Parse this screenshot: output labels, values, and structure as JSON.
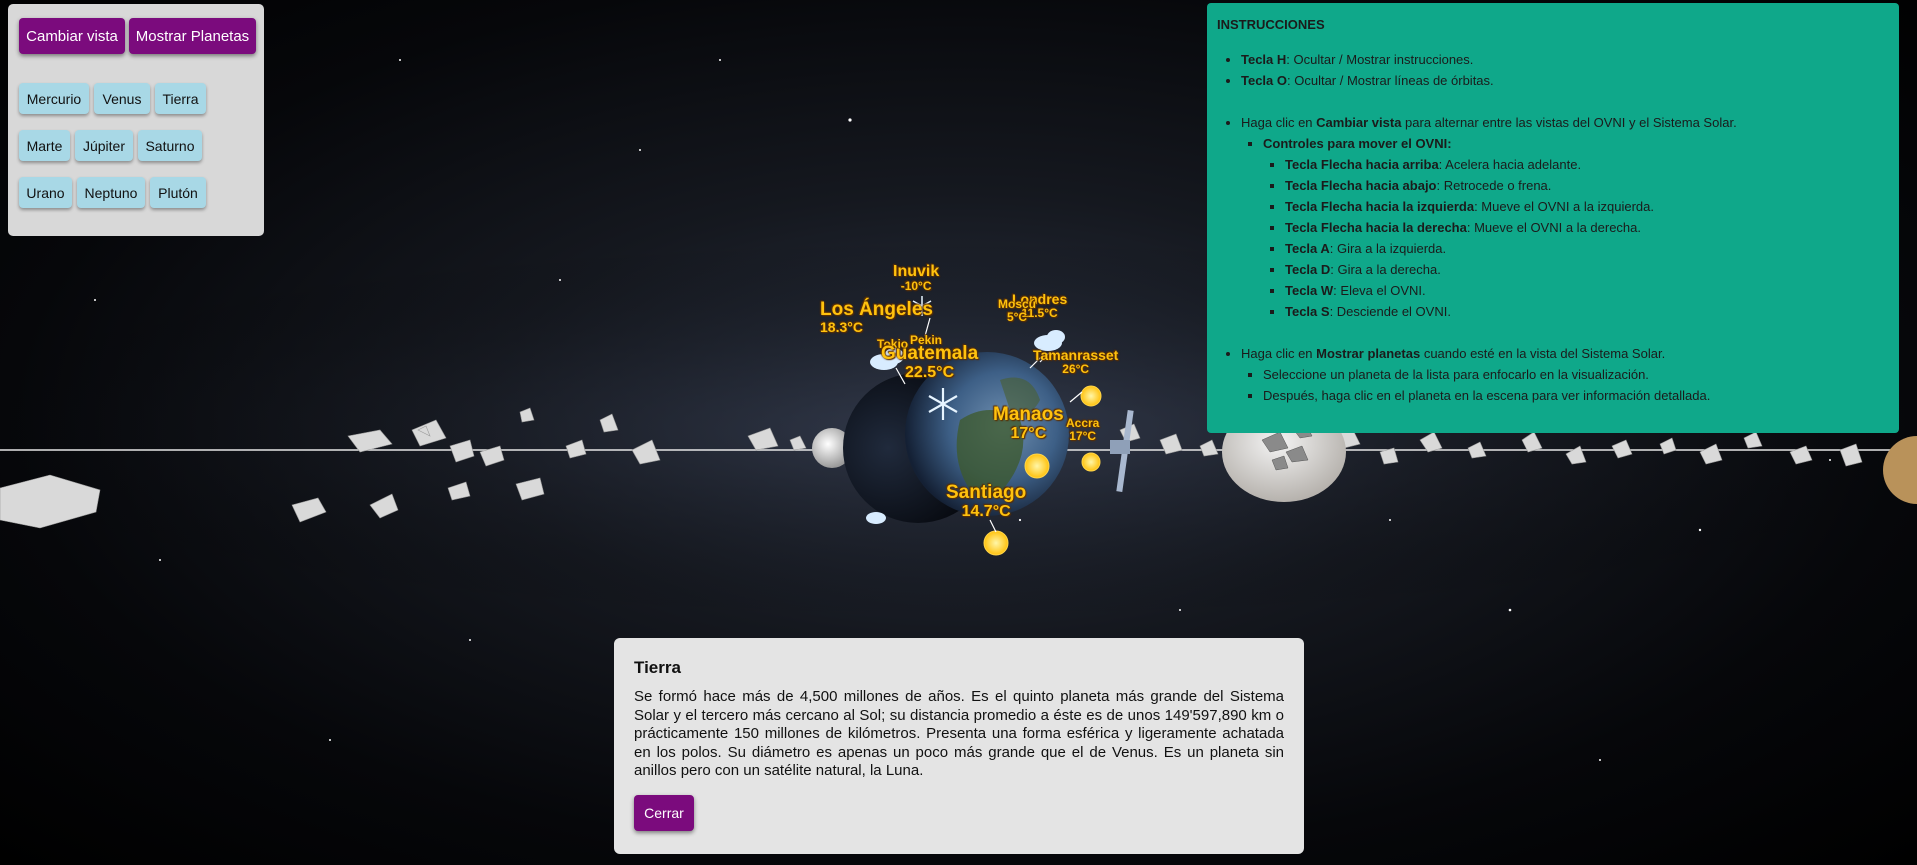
{
  "controls": {
    "view_button": "Cambiar vista",
    "planets_button": "Mostrar Planetas",
    "planets": [
      "Mercurio",
      "Venus",
      "Tierra",
      "Marte",
      "Júpiter",
      "Saturno",
      "Urano",
      "Neptuno",
      "Plutón"
    ]
  },
  "instructions": {
    "title": "INSTRUCCIONES",
    "keys": [
      {
        "key": "Tecla H",
        "text": ": Ocultar / Mostrar instrucciones."
      },
      {
        "key": "Tecla O",
        "text": ": Ocultar / Mostrar líneas de órbitas."
      }
    ],
    "view": {
      "pre": "Haga clic en ",
      "bold": "Cambiar vista",
      "post": " para alternar entre las vistas del OVNI y el Sistema Solar."
    },
    "ufo_title": "Controles para mover el OVNI:",
    "ufo_controls": [
      {
        "key": "Tecla Flecha hacia arriba",
        "text": ": Acelera hacia adelante."
      },
      {
        "key": "Tecla Flecha hacia abajo",
        "text": ": Retrocede o frena."
      },
      {
        "key": "Tecla Flecha hacia la izquierda",
        "text": ": Mueve el OVNI a la izquierda."
      },
      {
        "key": "Tecla Flecha hacia la derecha",
        "text": ": Mueve el OVNI a la derecha."
      },
      {
        "key": "Tecla A",
        "text": ": Gira a la izquierda."
      },
      {
        "key": "Tecla D",
        "text": ": Gira a la derecha."
      },
      {
        "key": "Tecla W",
        "text": ": Eleva el OVNI."
      },
      {
        "key": "Tecla S",
        "text": ": Desciende el OVNI."
      }
    ],
    "planets": {
      "pre": "Haga clic en ",
      "bold": "Mostrar planetas",
      "post": " cuando esté en la vista del Sistema Solar."
    },
    "planet_steps": [
      "Seleccione un planeta de la lista para enfocarlo en la visualización.",
      "Después, haga clic en el planeta en la escena para ver información detallada."
    ]
  },
  "info": {
    "title": "Tierra",
    "text": "Se formó hace más de 4,500 millones de años. Es el quinto planeta más grande del Sistema Solar y el tercero más cercano al Sol; su distancia promedio a éste es de unos 149'597,890 km o prácticamente 150 millones de kilómetros. Presenta una forma esférica y ligeramente achatada en los polos. Su diámetro es apenas un poco más grande que el de Venus. Es un planeta sin anillos pero con un satélite natural, la Luna.",
    "close": "Cerrar"
  },
  "weather": {
    "inuvik": {
      "city": "Inuvik",
      "temp": "-10°C"
    },
    "losangeles": {
      "city": "Los Ángeles",
      "temp": "18.3°C"
    },
    "tokio": {
      "city": "Tokio"
    },
    "pekin": {
      "city": "Pekin"
    },
    "guatemala": {
      "city": "Guatemala",
      "temp": "22.5°C"
    },
    "londres": {
      "city": "Londres",
      "temp": "11.5°C"
    },
    "moscu": {
      "city": "Moscú",
      "temp": "5°C"
    },
    "tamanrasset": {
      "city": "Tamanrasset",
      "temp": "26°C"
    },
    "manaos": {
      "city": "Manaos",
      "temp": "17°C"
    },
    "accra": {
      "city": "Accra",
      "temp": "17°C"
    },
    "santiago": {
      "city": "Santiago",
      "temp": "14.7°C"
    }
  },
  "colors": {
    "purple_button": "#7b0b7d",
    "planet_button": "#a8d8e6",
    "instructions_bg": "#0fa88a",
    "label_yellow": "#ffc20e"
  }
}
